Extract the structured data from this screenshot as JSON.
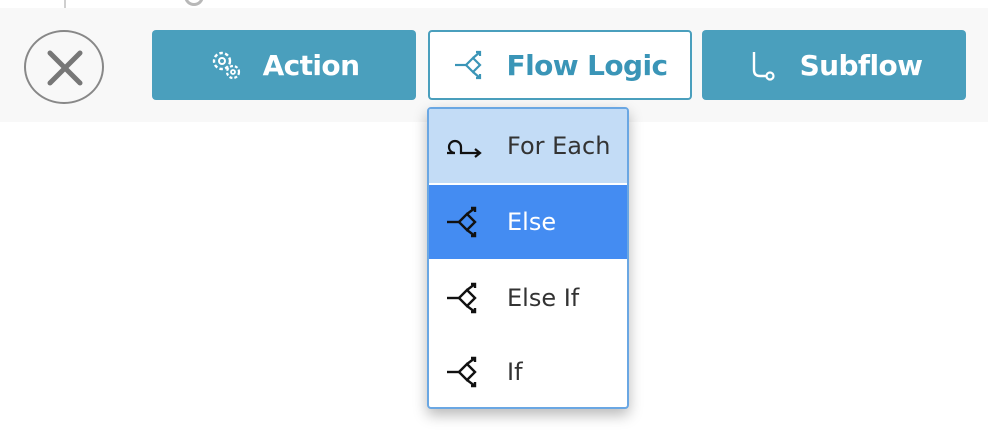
{
  "toolbar": {
    "close_icon": "close-x-icon",
    "buttons": [
      {
        "label": "Action",
        "icon": "gear-icon"
      },
      {
        "label": "Flow Logic",
        "icon": "flow-logic-icon"
      },
      {
        "label": "Subflow",
        "icon": "subflow-icon"
      }
    ]
  },
  "dropdown": {
    "items": [
      {
        "label": "For Each",
        "icon": "loop-arrow-icon",
        "state": "hover"
      },
      {
        "label": "Else",
        "icon": "branch-icon",
        "state": "selected"
      },
      {
        "label": "Else If",
        "icon": "branch-icon",
        "state": "normal"
      },
      {
        "label": "If",
        "icon": "branch-icon",
        "state": "normal"
      }
    ]
  },
  "colors": {
    "button_fill": "#4a9fbd",
    "highlight_light": "#c3dcf6",
    "highlight_selected": "#448cf2",
    "dropdown_border": "#6aa7e3"
  }
}
